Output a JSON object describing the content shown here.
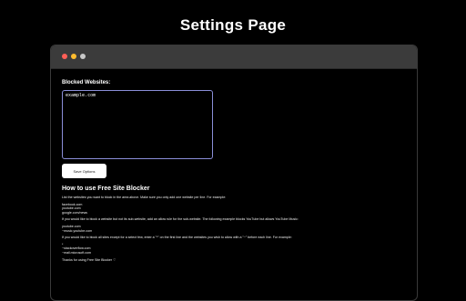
{
  "page_title": "Settings Page",
  "window": {
    "dot_colors": [
      "#ff5f57",
      "#febc2e",
      "#c8c8c8"
    ]
  },
  "settings": {
    "blocked_label": "Blocked Websites:",
    "textarea_value": "example.com",
    "save_label": "Save Options"
  },
  "howto": {
    "title": "How to use Free Site Blocker",
    "intro": "List the websites you want to block in the area above. Make sure you only add one website per line. For example:",
    "example1": [
      "facebook.com",
      "youtube.com",
      "google.com/news"
    ],
    "allow_intro": "If you would like to block a website but not its sub-website, add an allow rule for the sub-website. The following example blocks YouTube but allows YouTube Music:",
    "example2": [
      "youtube.com",
      "~music.youtube.com"
    ],
    "allowlist_intro": "If you would like to block all sites except for a select few, enter a \"*\" on the first line and the websites you wish to allow with a \"~\" before each line. For example:",
    "example3": [
      "*",
      "~stackoverflow.com",
      "~mail.microsoft.com"
    ],
    "thanks": "Thanks for using Free Site Blocker ♡"
  }
}
